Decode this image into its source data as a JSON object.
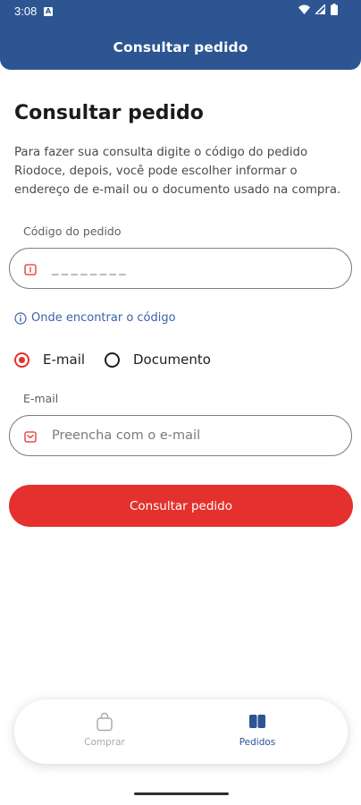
{
  "status_bar": {
    "time": "3:08",
    "notification_icon": "a-icon",
    "icons": [
      "wifi-icon",
      "signal-icon",
      "battery-icon"
    ]
  },
  "header": {
    "title": "Consultar pedido",
    "background_color": "#2c5592"
  },
  "main": {
    "title": "Consultar pedido",
    "intro": "Para fazer sua consulta digite o código do pedido Riodoce, depois, você pode escolher informar o endereço de e-mail ou o documento usado na compra.",
    "order_code": {
      "label": "Código do pedido",
      "placeholder": "________",
      "icon": "ticket-icon"
    },
    "help_link": {
      "label": "Onde encontrar o código",
      "icon": "info-icon"
    },
    "contact_method": {
      "options": [
        {
          "label": "E-mail",
          "selected": true
        },
        {
          "label": "Documento",
          "selected": false
        }
      ]
    },
    "email": {
      "label": "E-mail",
      "placeholder": "Preencha com o e-mail",
      "icon": "mail-icon"
    },
    "submit_label": "Consultar pedido",
    "accent_color": "#e4312d"
  },
  "bottom_nav": {
    "items": [
      {
        "label": "Comprar",
        "icon": "shopping-bag-icon",
        "active": false
      },
      {
        "label": "Pedidos",
        "icon": "orders-icon",
        "active": true
      }
    ]
  }
}
